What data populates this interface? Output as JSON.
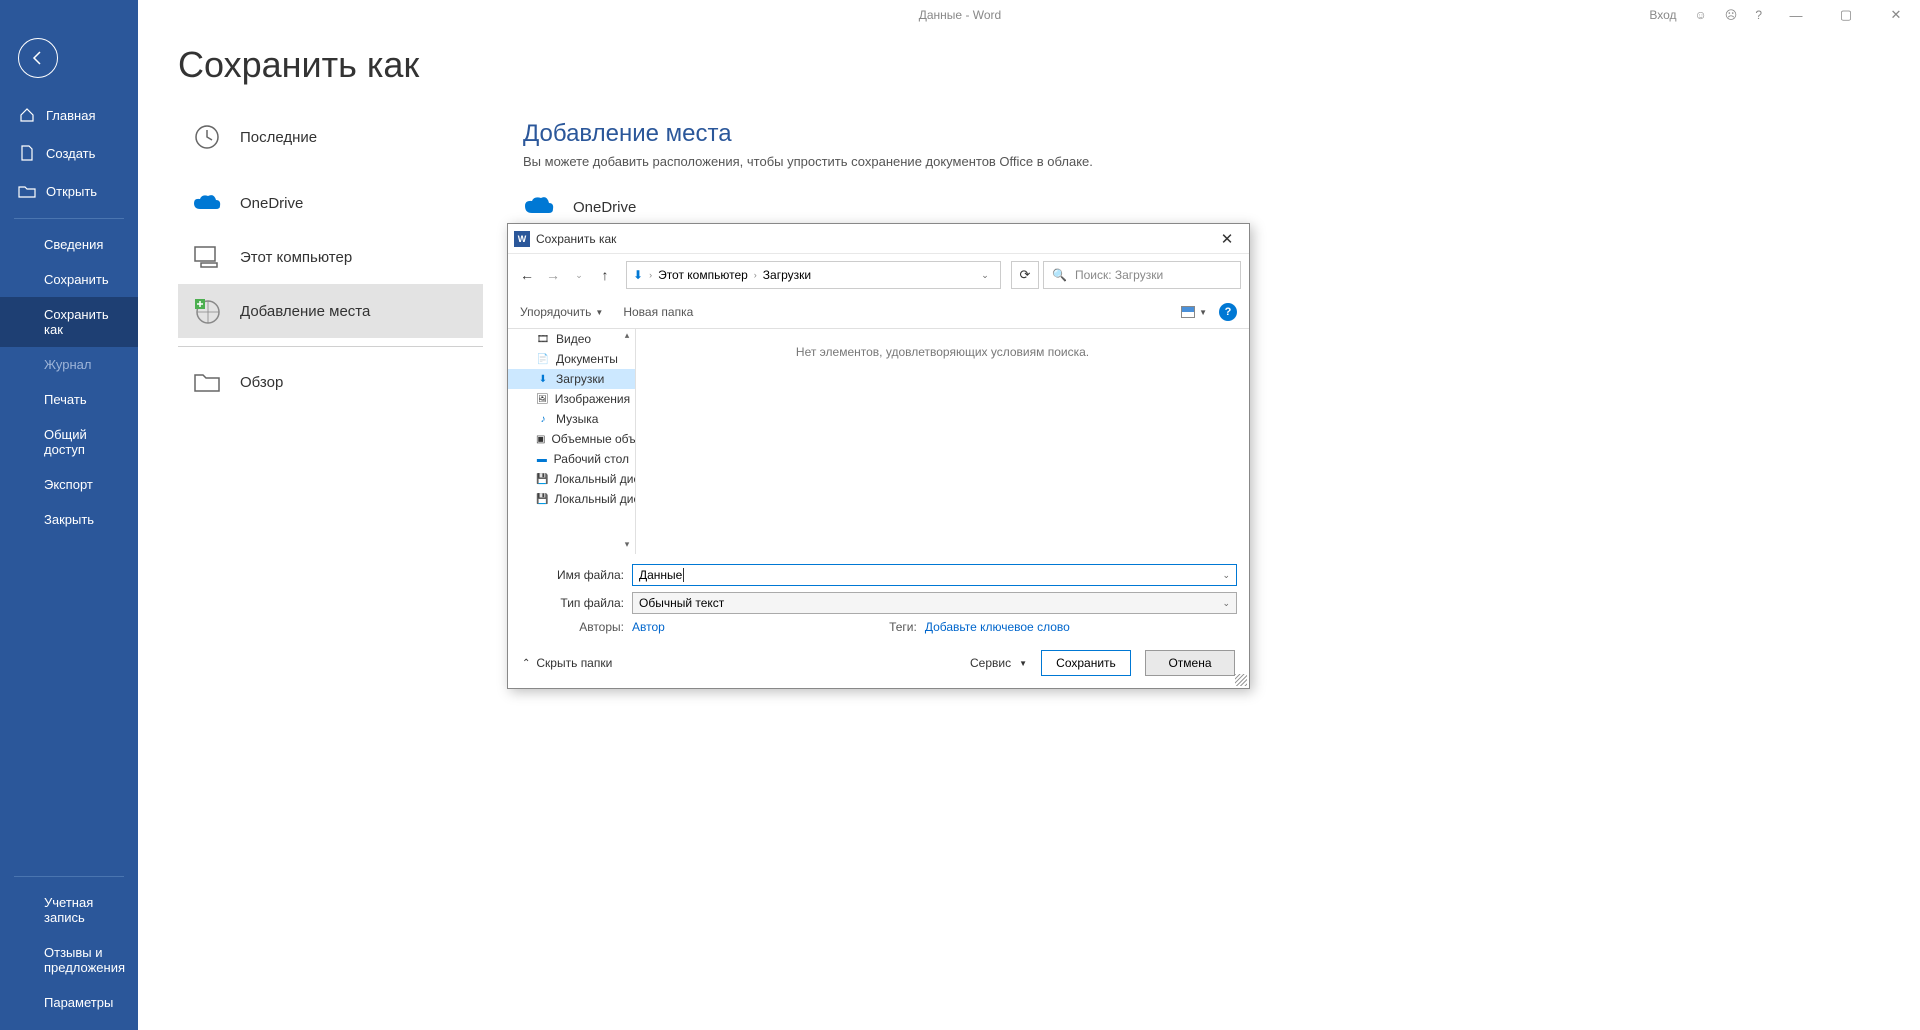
{
  "titlebar": {
    "doc_title": "Данные  -  Word",
    "sign_in": "Вход"
  },
  "sidebar": {
    "home": "Главная",
    "new": "Создать",
    "open": "Открыть",
    "info": "Сведения",
    "save": "Сохранить",
    "save_as": "Сохранить как",
    "history": "Журнал",
    "print": "Печать",
    "share": "Общий доступ",
    "export": "Экспорт",
    "close": "Закрыть",
    "account": "Учетная запись",
    "feedback": "Отзывы и предложения",
    "options": "Параметры"
  },
  "page": {
    "title": "Сохранить как"
  },
  "locations": {
    "recent": "Последние",
    "onedrive": "OneDrive",
    "this_pc": "Этот компьютер",
    "add_place": "Добавление места",
    "browse": "Обзор"
  },
  "detail": {
    "title": "Добавление места",
    "subtitle": "Вы можете добавить расположения, чтобы упростить сохранение документов Office в облаке.",
    "onedrive": "OneDrive"
  },
  "dialog": {
    "title": "Сохранить как",
    "breadcrumb": {
      "pc": "Этот компьютер",
      "downloads": "Загрузки"
    },
    "search_placeholder": "Поиск: Загрузки",
    "organize": "Упорядочить",
    "new_folder": "Новая папка",
    "tree": {
      "videos": "Видео",
      "documents": "Документы",
      "downloads": "Загрузки",
      "pictures": "Изображения",
      "music": "Музыка",
      "objects3d": "Объемные объекты",
      "desktop": "Рабочий стол",
      "local1": "Локальный диск",
      "local2": "Локальный диск"
    },
    "empty_message": "Нет элементов, удовлетворяющих условиям поиска.",
    "filename_label": "Имя файла:",
    "filename_value": "Данные",
    "filetype_label": "Тип файла:",
    "filetype_value": "Обычный текст",
    "authors_label": "Авторы:",
    "authors_value": "Автор",
    "tags_label": "Теги:",
    "tags_value": "Добавьте ключевое слово",
    "hide_folders": "Скрыть папки",
    "service": "Сервис",
    "save_btn": "Сохранить",
    "cancel_btn": "Отмена"
  }
}
